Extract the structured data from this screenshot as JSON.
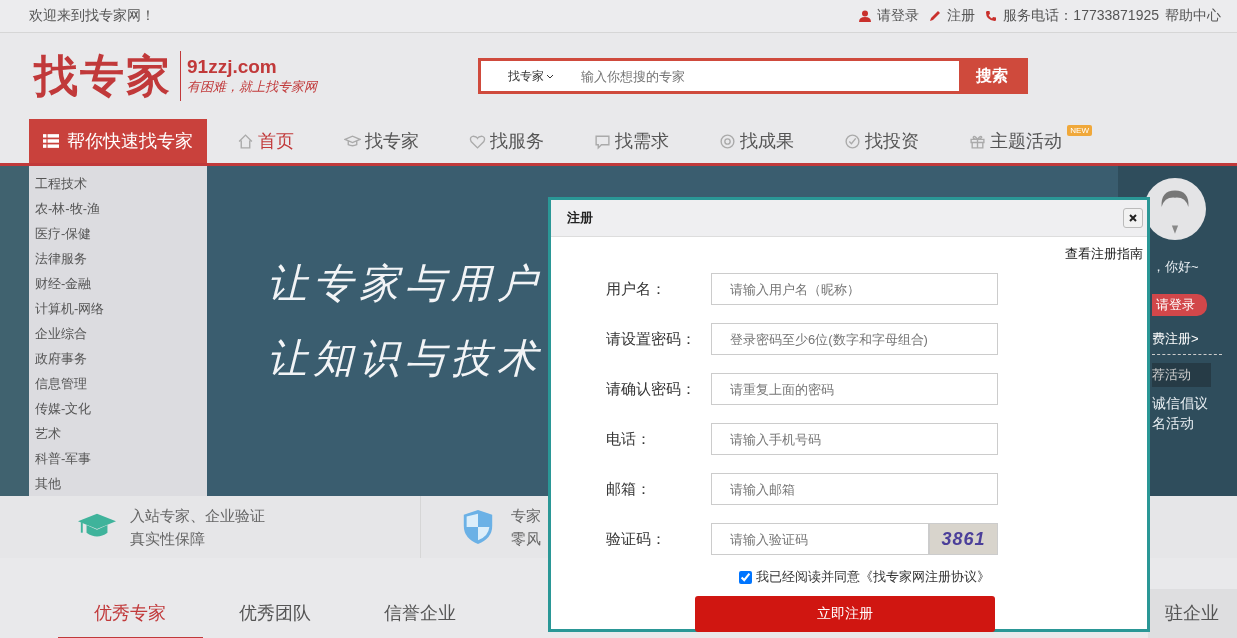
{
  "top_bar": {
    "welcome": "欢迎来到找专家网！",
    "login": "请登录",
    "register": "注册",
    "phone": "服务电话：17733871925",
    "help": "帮助中心"
  },
  "header": {
    "logo": "找专家",
    "domain": "91zzj.com",
    "slogan": "有困难，就上找专家网",
    "search": {
      "scope": "找专家",
      "placeholder": "输入你想搜的专家",
      "button": "搜索"
    }
  },
  "nav": {
    "category_button": "帮你快速找专家",
    "items": [
      {
        "label": "首页",
        "selected": true
      },
      {
        "label": "找专家",
        "selected": false
      },
      {
        "label": "找服务",
        "selected": false
      },
      {
        "label": "找需求",
        "selected": false
      },
      {
        "label": "找成果",
        "selected": false
      },
      {
        "label": "找投资",
        "selected": false
      },
      {
        "label": "主题活动",
        "selected": false,
        "badge": "NEW"
      }
    ]
  },
  "categories": [
    "工程技术",
    "农-林-牧-渔",
    "医疗-保健",
    "法律服务",
    "财经-金融",
    "计算机-网络",
    "企业综合",
    "政府事务",
    "信息管理",
    "传媒-文化",
    "艺术",
    "科普-军事",
    "其他"
  ],
  "banner": {
    "lines": [
      "让专家与用户",
      "让知识与技术"
    ]
  },
  "user_panel": {
    "greeting": "，你好~",
    "login": "请登录",
    "register": "费注册>",
    "section": "荐活动",
    "links": [
      "诚信倡议",
      "名活动"
    ]
  },
  "features": [
    {
      "lines": [
        "入站专家、企业验证",
        "真实性保障"
      ]
    },
    {
      "lines": [
        "专家",
        "零风"
      ]
    }
  ],
  "tabs": [
    {
      "label": "优秀专家",
      "selected": true
    },
    {
      "label": "优秀团队",
      "selected": false
    },
    {
      "label": "信誉企业",
      "selected": false
    },
    {
      "label": "驻企业",
      "selected": false
    }
  ],
  "dialog": {
    "title": "注册",
    "guide_link": "查看注册指南",
    "fields": [
      {
        "kind": "text",
        "label": "用户名：",
        "placeholder": "请输入用户名（昵称）"
      },
      {
        "kind": "text",
        "label": "请设置密码：",
        "placeholder": "登录密码至少6位(数字和字母组合)"
      },
      {
        "kind": "text",
        "label": "请确认密码：",
        "placeholder": "请重复上面的密码"
      },
      {
        "kind": "text",
        "label": "电话：",
        "placeholder": "请输入手机号码"
      },
      {
        "kind": "text",
        "label": "邮箱：",
        "placeholder": "请输入邮箱"
      },
      {
        "kind": "captcha",
        "label": "验证码：",
        "placeholder": "请输入验证码",
        "captcha": "3861"
      }
    ],
    "agreement": {
      "checked": true,
      "text": "我已经阅读并同意《找专家网注册协议》"
    },
    "submit": "立即注册"
  }
}
